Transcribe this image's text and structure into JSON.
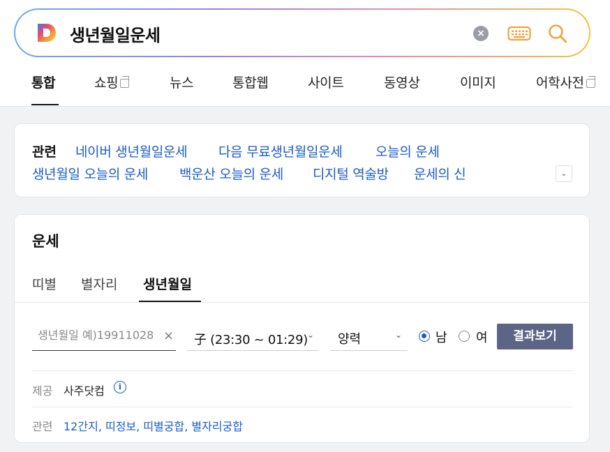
{
  "search": {
    "query": "생년월일운세",
    "clear_icon": "close-circle-icon",
    "keyboard_icon": "keyboard-icon",
    "search_icon": "search-icon",
    "brand_colors": [
      "#6aa8f5",
      "#9a7ff0",
      "#e58bb2",
      "#f6c13b"
    ]
  },
  "tabs": [
    {
      "label": "통합",
      "active": true
    },
    {
      "label": "쇼핑",
      "external": true
    },
    {
      "label": "뉴스"
    },
    {
      "label": "통합웹"
    },
    {
      "label": "사이트"
    },
    {
      "label": "동영상"
    },
    {
      "label": "이미지"
    },
    {
      "label": "어학사전",
      "external": true
    }
  ],
  "related": {
    "label": "관련",
    "links": [
      "네이버 생년월일운세",
      "다음 무료생년월일운세",
      "오늘의 운세",
      "생년월일 오늘의 운세",
      "백운산 오늘의 운세",
      "디지털 역술방",
      "운세의 신"
    ],
    "toggle_icon": "chevron-down-icon"
  },
  "fortune": {
    "title": "운세",
    "tabs": [
      {
        "label": "띠별"
      },
      {
        "label": "별자리"
      },
      {
        "label": "생년월일",
        "active": true
      }
    ],
    "birth_placeholder": "생년월일 예)19911028",
    "birth_value": "",
    "time_value": "子 (23:30 ~ 01:29)",
    "calendar_value": "양력",
    "gender_options": [
      {
        "label": "남",
        "checked": true
      },
      {
        "label": "여",
        "checked": false
      }
    ],
    "result_button": "결과보기",
    "provider_label": "제공",
    "provider_value": "사주닷컴",
    "related_label": "관련",
    "related_links": [
      "12간지",
      "띠정보",
      "띠별궁합",
      "별자리궁합"
    ],
    "accent_color": "#1b5dc7",
    "button_color": "#5c6585"
  }
}
